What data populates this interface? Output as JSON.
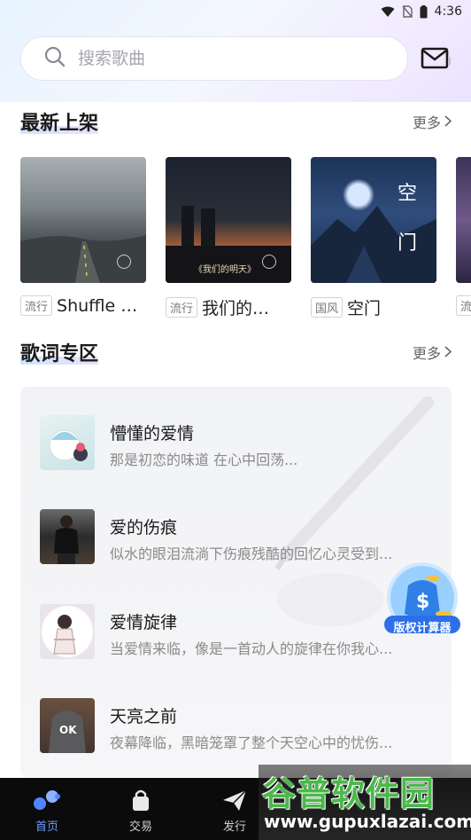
{
  "status_bar": {
    "time": "4:36"
  },
  "search": {
    "placeholder": "搜索歌曲"
  },
  "new_releases": {
    "title": "最新上架",
    "more": "更多",
    "albums": [
      {
        "genre": "流行",
        "title": "Shuffle P..."
      },
      {
        "genre": "流行",
        "title": "我们的明..."
      },
      {
        "genre": "国风",
        "title": "空门"
      },
      {
        "genre": "流",
        "title": ""
      }
    ]
  },
  "lyrics_zone": {
    "title": "歌词专区",
    "more": "更多",
    "items": [
      {
        "title": "懵懂的爱情",
        "desc": "那是初恋的味道 在心中回荡..."
      },
      {
        "title": "爱的伤痕",
        "desc": "似水的眼泪流淌下伤痕残酷的回忆心灵受到..."
      },
      {
        "title": "爱情旋律",
        "desc": "当爱情来临，像是一首动人的旋律在你我心..."
      },
      {
        "title": "天亮之前",
        "desc": "夜幕降临，黑暗笼罩了整个天空心中的忧伤..."
      }
    ]
  },
  "cover_text": {
    "album2": "《我们的明天》",
    "album3": "空门"
  },
  "float_badge": {
    "label": "版权计算器"
  },
  "bottom_nav": {
    "items": [
      {
        "label": "首页"
      },
      {
        "label": "交易"
      },
      {
        "label": "发行"
      }
    ]
  },
  "watermark": {
    "title": "谷普软件园",
    "url": "www.gupuxlazai.com"
  }
}
